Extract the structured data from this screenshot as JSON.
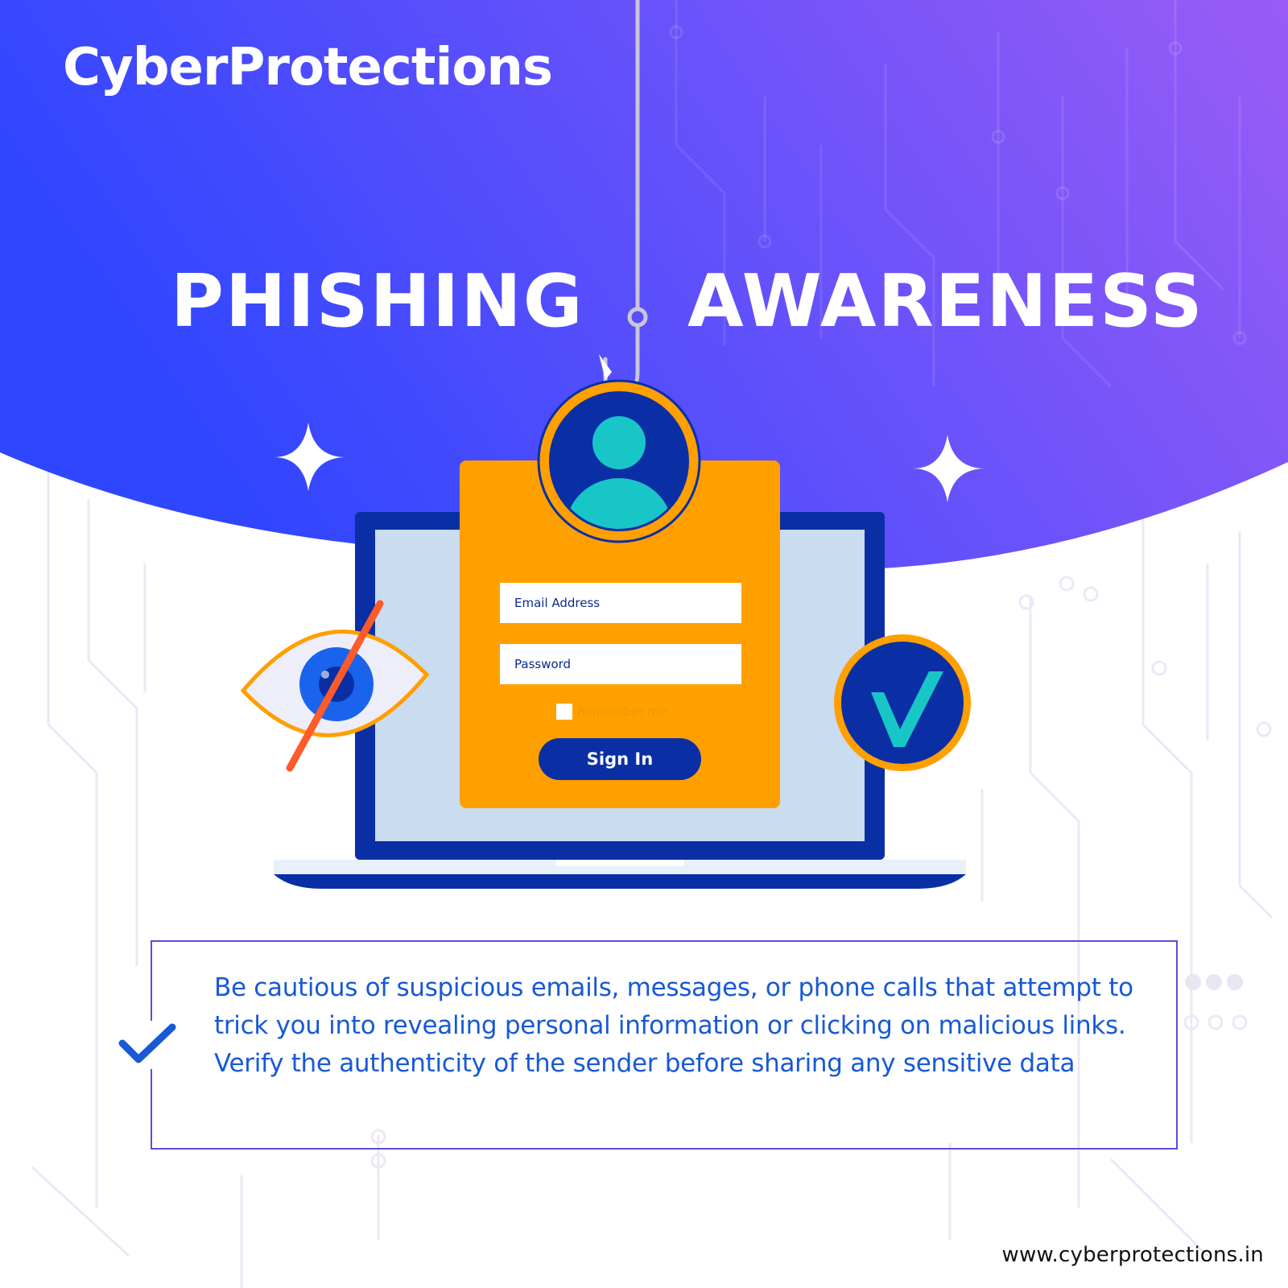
{
  "brand": {
    "name": "CyberProtections"
  },
  "headline": {
    "left": "PHISHING",
    "right": "AWARENESS"
  },
  "login_form": {
    "email_placeholder": "Email Address",
    "password_placeholder": "Password",
    "remember_label": "Remember me",
    "sign_in_label": "Sign In"
  },
  "tip": {
    "text": " Be cautious of suspicious emails, messages, or phone calls that attempt to trick you into revealing personal information or clicking on malicious links. Verify the authenticity of the sender before sharing any sensitive data"
  },
  "footer": {
    "url": "www.cyberprotections.in"
  },
  "colors": {
    "gradient_start": "#2f46ff",
    "gradient_end": "#9a5cf6",
    "card_orange": "#ff9f00",
    "navy": "#0a2fa5",
    "teal": "#18c6c8",
    "tip_text": "#1759d6",
    "eye_slash": "#ff5a2a"
  },
  "icons": {
    "avatar": "user-avatar-icon",
    "eye": "eye-slash-icon",
    "verified": "checkmark-badge-icon",
    "hook": "fishing-hook-icon",
    "tip_check": "check-icon",
    "sparkle": "sparkle-icon"
  }
}
